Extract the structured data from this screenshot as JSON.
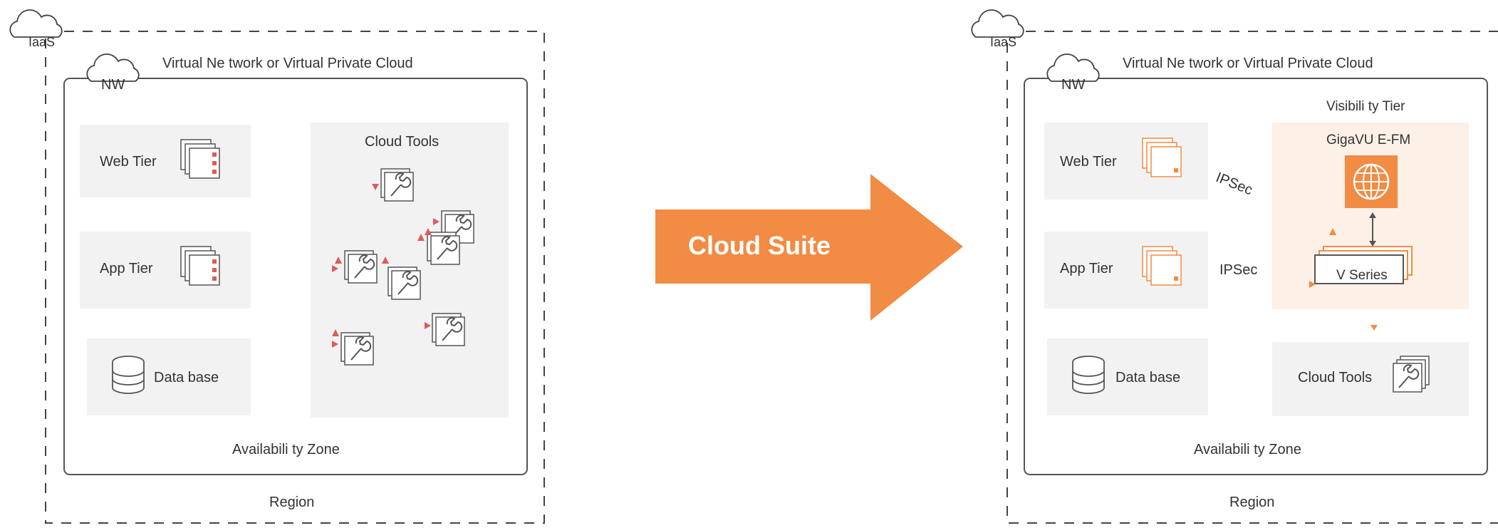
{
  "left": {
    "iaas": "IaaS",
    "vnet": "Virtual Ne twork or Virtual  Private Cloud",
    "nw": "NW",
    "web_tier": "Web Tier",
    "app_tier": "App  Tier",
    "database": "Data base",
    "cloud_tools": "Cloud  Tools",
    "az": "Availabili ty Zone",
    "region": "Region"
  },
  "arrow": {
    "label": "Cloud Suite",
    "color": "#f28b43"
  },
  "right": {
    "iaas": "IaaS",
    "vnet": "Virtual Ne twork or Virtual  Private Cloud",
    "nw": "NW",
    "web_tier": "Web Tier",
    "app_tier": "App  Tier",
    "database": "Data base",
    "ipsec_1": "IPSec",
    "ipsec_2": "IPSec",
    "visibility_tier": "Visibili ty Tier",
    "gigavue": "GigaVU E-FM",
    "v_series": "V Series",
    "cloud_tools": "Cloud  Tools",
    "az": "Availabili ty Zone",
    "region": "Region"
  },
  "colors": {
    "accent": "#f28b43",
    "tier_bg": "#eeeeee",
    "visibility_bg": "#fdf0e6",
    "tool_marker": "#e05a5a"
  }
}
